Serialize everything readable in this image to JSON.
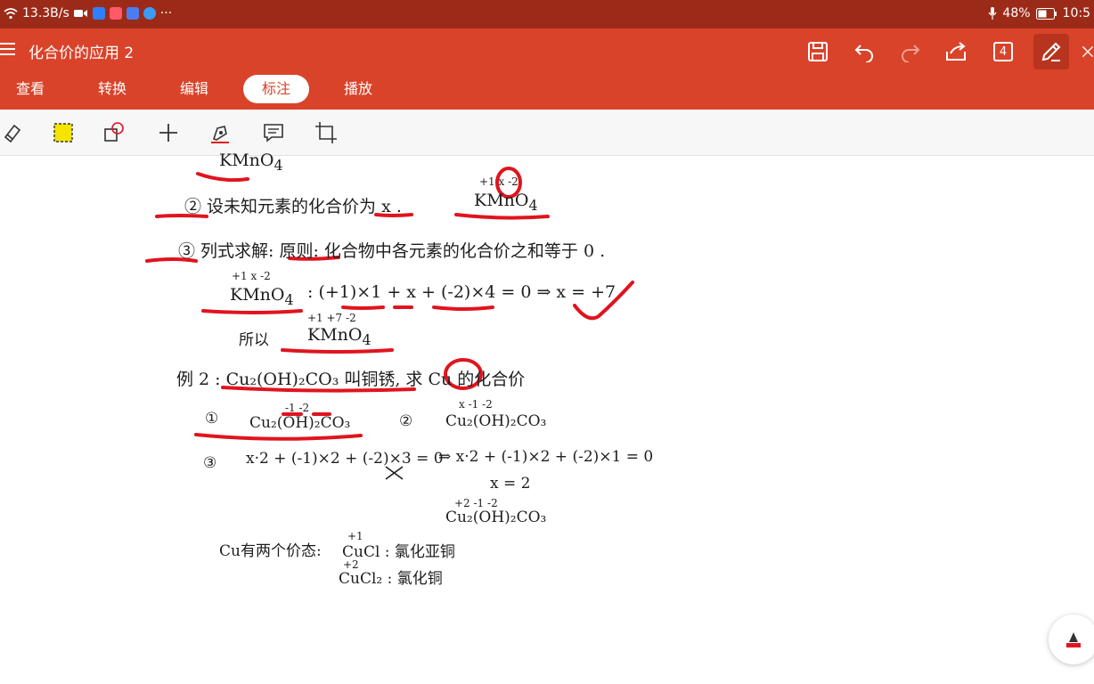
{
  "status": {
    "speed": "13.3B/s",
    "more": "···",
    "battery": "48%",
    "time": "10:5"
  },
  "header": {
    "title": "化合价的应用 2",
    "page_count": "4"
  },
  "tabs": [
    {
      "label": "查看"
    },
    {
      "label": "转换"
    },
    {
      "label": "编辑"
    },
    {
      "label": "标注"
    },
    {
      "label": "播放"
    }
  ],
  "note": {
    "line0": "KMnO",
    "line0_sub": "4",
    "step2": "② 设未知元素的化合价为 x .",
    "step2_val": "+1  x  -2",
    "step2_formula": "KMnO",
    "step2_sub": "4",
    "step3": "③ 列式求解: 原则: 化合物中各元素的化合价之和等于 0 .",
    "eq1_val": "+1  x  -2",
    "eq1_formula": "KMnO",
    "eq1_sub": "4",
    "eq1": ":  (+1)×1 + x + (-2)×4 = 0    ⇒  x = +7",
    "so_label": "所以",
    "so_val": "+1  +7  -2",
    "so_formula": "KMnO",
    "so_sub": "4",
    "ex2": "例 2 :  Cu₂(OH)₂CO₃ 叫铜锈, 求 Cu 的化合价",
    "ex2_1": "①",
    "ex2_1_val": "-1   -2",
    "ex2_1_formula": "Cu₂(OH)₂CO₃",
    "ex2_2": "②",
    "ex2_2_val": "x    -1    -2",
    "ex2_2_formula": "Cu₂(OH)₂CO₃",
    "ex2_3": "③",
    "eq2_wrong": "x·2 + (-1)×2 + (-2)×3 = 0",
    "eq2_right": "⇒  x·2 + (-1)×2 + (-2)×1 = 0",
    "eq2_result": "x = 2",
    "final_val": "+2   -1   -2",
    "final_formula": "Cu₂(OH)₂CO₃",
    "cu_label": "Cu有两个价态:",
    "cu1_val": "+1",
    "cu1": "CuCl : 氯化亚铜",
    "cu2_val": "+2",
    "cu2": "CuCl₂ : 氯化铜"
  },
  "colors": {
    "status_bar": "#9b2b18",
    "app_bar": "#d9432a",
    "ink_red": "#e0141e",
    "highlighter": "#f5e400"
  },
  "icons": [
    "wifi-icon",
    "video-icon",
    "search-app-icon",
    "mail-app-icon",
    "browser-app-icon",
    "mic-icon",
    "battery-icon",
    "menu-icon",
    "save-icon",
    "undo-icon",
    "redo-icon",
    "share-icon",
    "pages-icon",
    "pen-icon",
    "close-icon",
    "eraser-icon",
    "highlighter-icon",
    "shape-icon",
    "add-icon",
    "pen-style-icon",
    "comment-icon",
    "crop-icon",
    "ink-color-icon"
  ]
}
